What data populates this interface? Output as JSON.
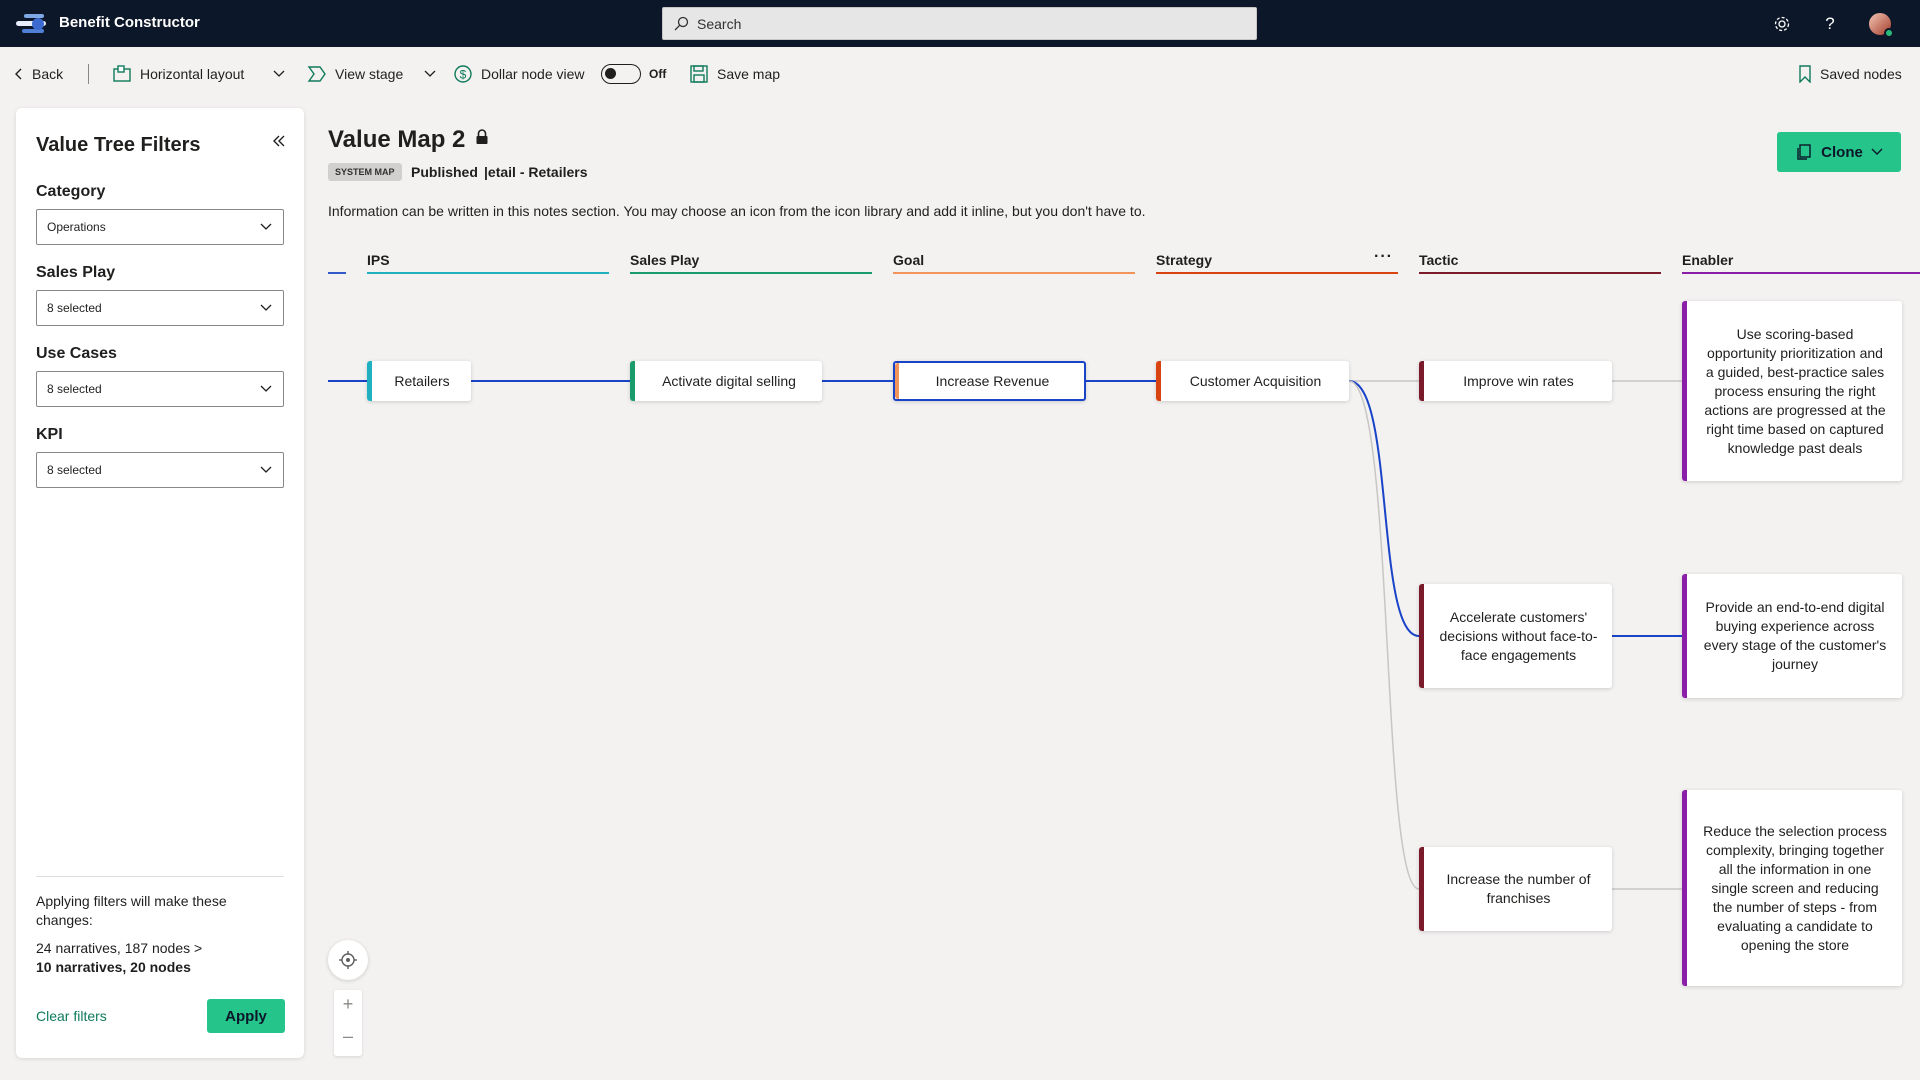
{
  "app": {
    "title": "Benefit Constructor"
  },
  "search": {
    "placeholder": "Search"
  },
  "toolbar": {
    "back_label": "Back",
    "layout_label": "Horizontal layout",
    "view_stage_label": "View stage",
    "dollar_node_label": "Dollar node view",
    "toggle_state": "Off",
    "save_map_label": "Save map",
    "saved_nodes_label": "Saved nodes"
  },
  "sidebar": {
    "title": "Value Tree Filters",
    "filters": [
      {
        "label": "Category",
        "value": "Operations"
      },
      {
        "label": "Sales Play",
        "value": "8 selected"
      },
      {
        "label": "Use Cases",
        "value": "8 selected"
      },
      {
        "label": "KPI",
        "value": "8 selected"
      }
    ],
    "note": "Applying filters will make these changes:",
    "counts_before": "24 narratives, 187 nodes >",
    "counts_after": "10 narratives, 20 nodes",
    "clear_label": "Clear filters",
    "apply_label": "Apply"
  },
  "map": {
    "title": "Value Map 2",
    "badge": "SYSTEM MAP",
    "status": "Published",
    "name": "|etail - Retailers",
    "notes": "Information can be written in this notes section. You may choose an icon from the icon library and add it inline, but you don't have to.",
    "clone_label": "Clone",
    "columns": [
      {
        "label": "IPS",
        "color": "#1fb1c0"
      },
      {
        "label": "Sales Play",
        "color": "#1a9b6c"
      },
      {
        "label": "Goal",
        "color": "#f2935c"
      },
      {
        "label": "Strategy",
        "color": "#d8430f"
      },
      {
        "label": "Tactic",
        "color": "#7a1a2a"
      },
      {
        "label": "Enabler",
        "color": "#8a1ea8"
      }
    ],
    "nodes": {
      "ips": "Retailers",
      "sales_play": "Activate digital selling",
      "goal": "Increase Revenue",
      "strategy": "Customer Acquisition",
      "tactic_1": "Improve win rates",
      "tactic_2": "Accelerate customers' decisions without face-to-face engagements",
      "tactic_3": "Increase the number of franchises",
      "enabler_1": "Use scoring-based opportunity prioritization and a guided, best-practice sales process ensuring the right actions are progressed at the right time based on captured knowledge past deals",
      "enabler_2": "Provide an end-to-end digital buying experience across every stage of the customer's journey",
      "enabler_3": "Reduce the selection process complexity, bringing together all the information in one single screen and reducing the number of steps - from evaluating a candidate to opening the store"
    }
  },
  "colors": {
    "accent_green": "#25c48a",
    "link_blue": "#1a44c8",
    "topbar": "#0c1729"
  }
}
